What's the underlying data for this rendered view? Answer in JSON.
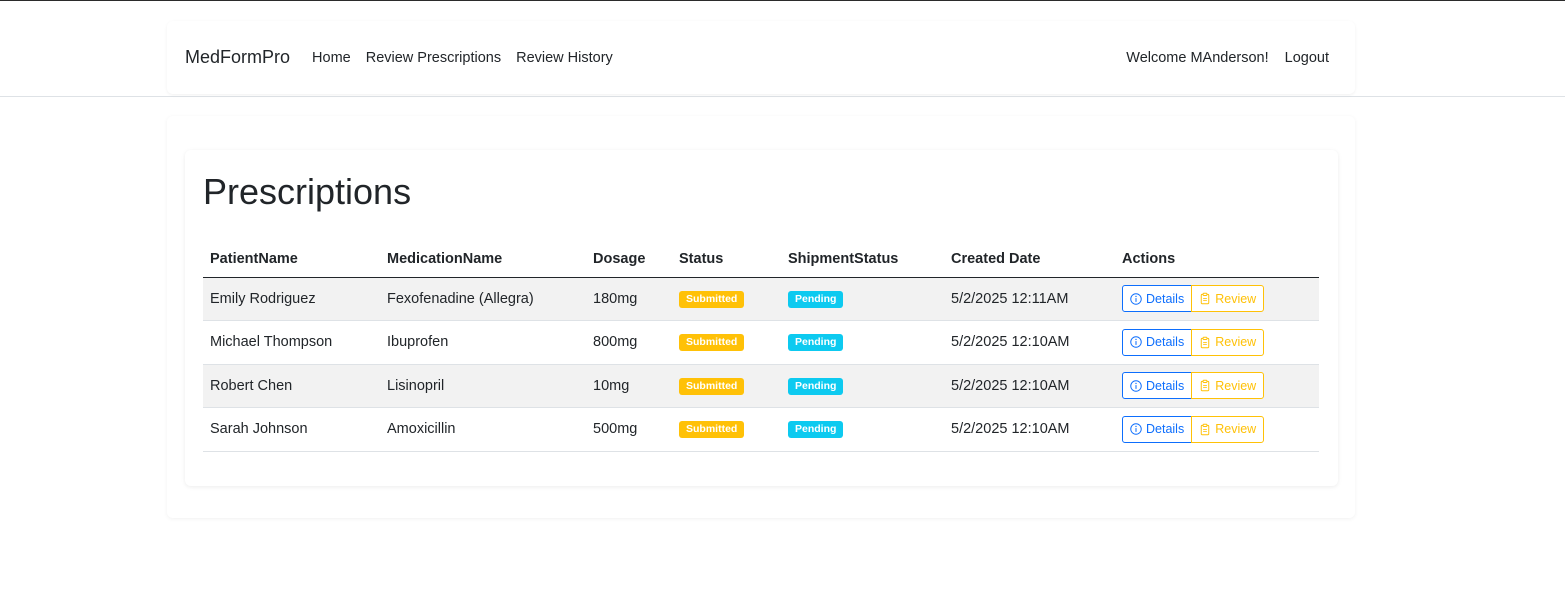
{
  "nav": {
    "brand": "MedFormPro",
    "links": [
      "Home",
      "Review Prescriptions",
      "Review History"
    ],
    "welcome": "Welcome MAnderson!",
    "logout": "Logout"
  },
  "page": {
    "title": "Prescriptions"
  },
  "table": {
    "headers": [
      "PatientName",
      "MedicationName",
      "Dosage",
      "Status",
      "ShipmentStatus",
      "Created Date",
      "Actions"
    ],
    "rows": [
      {
        "patient": "Emily Rodriguez",
        "medication": "Fexofenadine (Allegra)",
        "dosage": "180mg",
        "status": "Submitted",
        "shipment": "Pending",
        "created": "5/2/2025 12:11AM"
      },
      {
        "patient": "Michael Thompson",
        "medication": "Ibuprofen",
        "dosage": "800mg",
        "status": "Submitted",
        "shipment": "Pending",
        "created": "5/2/2025 12:10AM"
      },
      {
        "patient": "Robert Chen",
        "medication": "Lisinopril",
        "dosage": "10mg",
        "status": "Submitted",
        "shipment": "Pending",
        "created": "5/2/2025 12:10AM"
      },
      {
        "patient": "Sarah Johnson",
        "medication": "Amoxicillin",
        "dosage": "500mg",
        "status": "Submitted",
        "shipment": "Pending",
        "created": "5/2/2025 12:10AM"
      }
    ],
    "actions": {
      "details": "Details",
      "review": "Review"
    }
  },
  "icons": {
    "details": "info-circle-icon",
    "review": "clipboard-icon"
  },
  "colors": {
    "primary": "#0d6efd",
    "warning": "#ffc107",
    "info": "#0dcaf0",
    "stripe": "#f2f2f2"
  }
}
